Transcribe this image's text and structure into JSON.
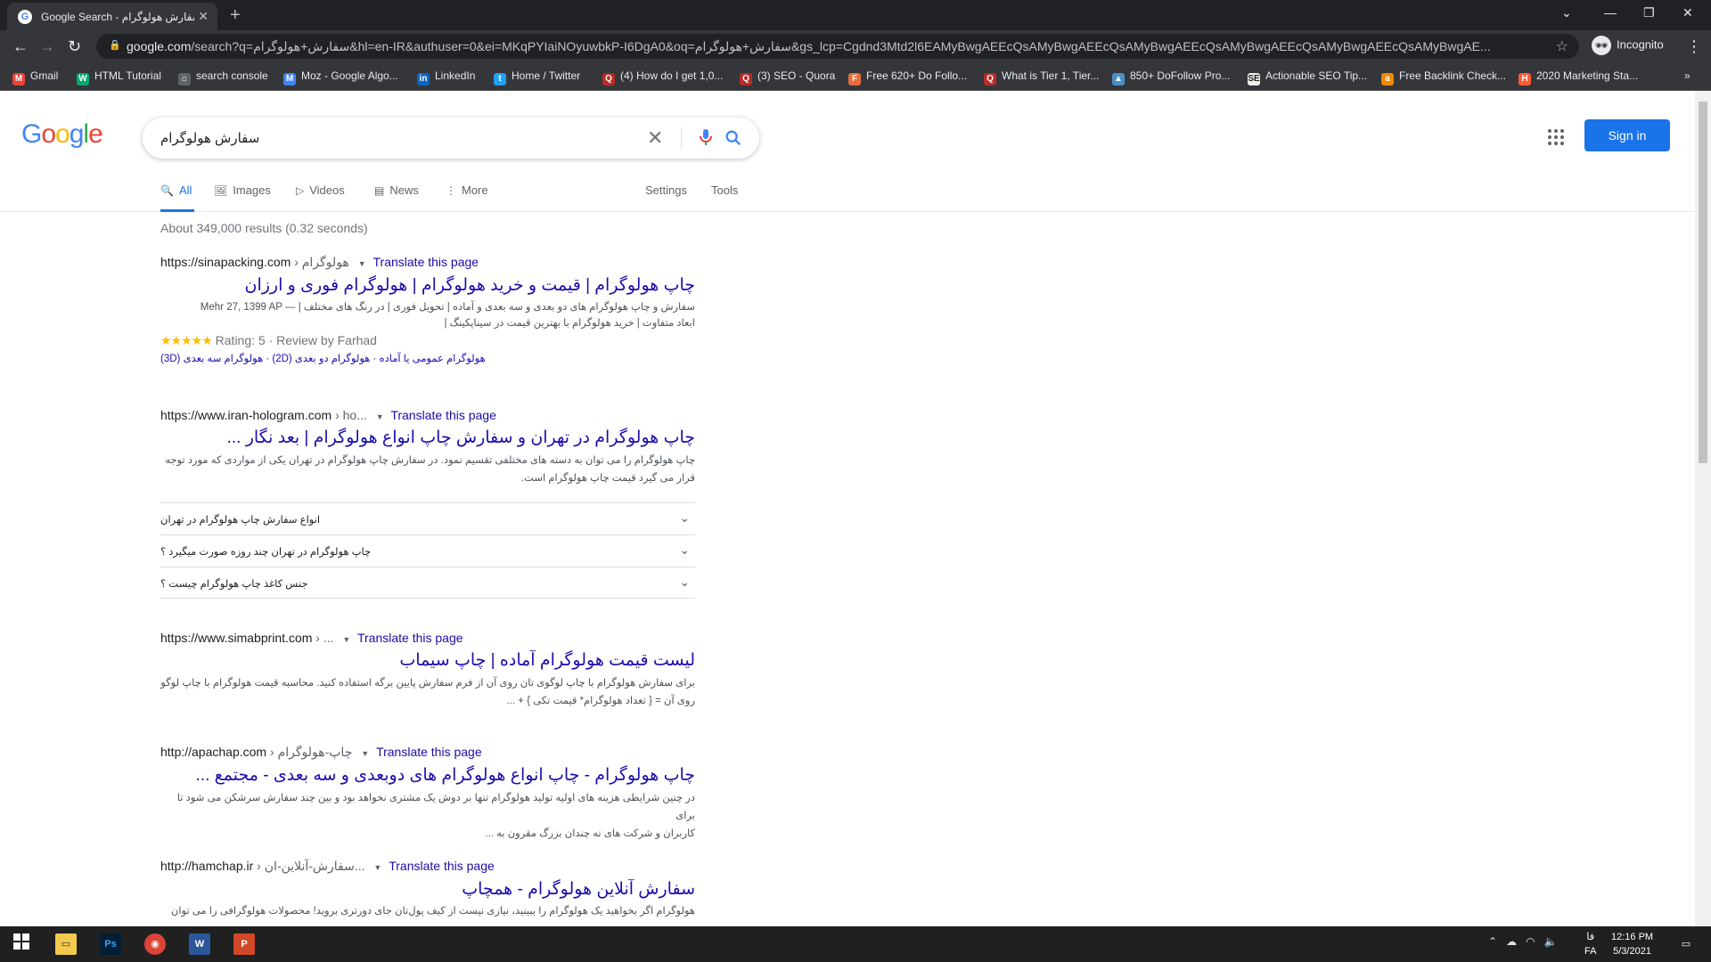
{
  "browser": {
    "tab_title": "Google Search - سفارش هولوگرام",
    "url_host": "google.com",
    "url_rest": "/search?q=سفارش+هولوگرام&hl=en-IR&authuser=0&ei=MKqPYIaiNOyuwbkP-I6DgA0&oq=سفارش+هولوگرام&gs_lcp=Cgdnd3Mtd2l6EAMyBwgAEEcQsAMyBwgAEEcQsAMyBwgAEEcQsAMyBwgAEEcQsAMyBwgAEEcQsAMyBwgAE...",
    "profile_label": "Incognito",
    "bookmarks": [
      "Gmail",
      "HTML Tutorial",
      "search console",
      "Moz - Google Algo...",
      "LinkedIn",
      "Home / Twitter",
      "(4) How do I get 1,0...",
      "(3) SEO - Quora",
      "Free 620+ Do Follo...",
      "What is Tier 1, Tier...",
      "850+ DoFollow Pro...",
      "Actionable SEO Tip...",
      "Free Backlink Check...",
      "2020 Marketing Sta..."
    ]
  },
  "google": {
    "query": "سفارش هولوگرام",
    "signin_label": "Sign in",
    "tabs": [
      "All",
      "Images",
      "Videos",
      "News",
      "More"
    ],
    "settings_label": "Settings",
    "tools_label": "Tools",
    "stats": "About 349,000 results (0.32 seconds)",
    "translate_label": "Translate this page"
  },
  "results": [
    {
      "url": "https://sinapacking.com",
      "path": "› هولوگرام",
      "title": "چاپ هولوگرام | قیمت و خرید هولوگرام | هولوگرام فوری و ارزان",
      "snippet_line1": "سفارش و چاپ هولوگرام های دو بعدی و سه بعدی و آماده | تحویل فوری | در رنگ های مختلف | — Mehr 27, 1399 AP",
      "snippet_line2": "ابعاد متفاوت | خرید هولوگرام با بهترین قیمت در سیناپکینگ |",
      "rating_text": "Rating: 5 · Review by Farhad",
      "stars": "★★★★★",
      "sitelinks": "هولوگرام عمومی یا آماده · هولوگرام دو بعدی (2D) · هولوگرام سه بعدی (3D)"
    },
    {
      "url": "https://www.iran-hologram.com",
      "path": "› ho...",
      "title": "چاپ هولوگرام در تهران و سفارش چاپ انواع هولوگرام | بعد نگار ...",
      "snippet_line1": "چاپ هولوگرام را می توان به دسته های مختلفی تقسیم نمود. در سفارش چاپ هولوگرام در تهران یکی از مواردی که مورد توجه",
      "snippet_line2": "قرار می گیرد قیمت چاپ هولوگرام است.",
      "faqs": [
        "انواع سفارش چاپ هولوگرام در تهران",
        "چاپ هولوگرام در تهران چند روزه صورت میگیرد ؟",
        "جنس کاغذ چاپ هولوگرام چیست ؟"
      ]
    },
    {
      "url": "https://www.simabprint.com",
      "path": "› ...",
      "title": "لیست قیمت هولوگرام آماده | چاپ سیماب",
      "snippet_line1": "برای سفارش هولوگرام با چاپ لوگوی تان روی آن از فرم سفارش پایین برگه استفاده کنید. محاسبه قیمت هولوگرام با چاپ لوگو",
      "snippet_line2": "روی آن = { تعداد هولوگرام* قیمت تکی } + ..."
    },
    {
      "url": "http://apachap.com",
      "path": "› چاپ-هولوگرام",
      "title": "چاپ هولوگرام - چاپ انواع هولوگرام های دوبعدی و سه بعدی - مجتمع ...",
      "snippet_line1": "در چنین شرایطی هزینه های اولیه تولید هولوگرام تنها بر دوش یک مشتری نخواهد بود و بین چند سفارش سرشکن می شود تا برای",
      "snippet_line2": "کاربران و شرکت های نه چندان بزرگ مقرون به ..."
    },
    {
      "url": "http://hamchap.ir",
      "path": "› سفارش-آنلاین-ان...",
      "title": "سفارش آنلاین هولوگرام - همچاپ",
      "snippet_line1": "هولوگرام اگر بخواهید یک هولوگرام را ببینید، نیازی نیست از کیف پول‌تان جای دورتری بروید! محصولات هولوگرافی را می توان"
    }
  ],
  "taskbar": {
    "time": "12:16 PM",
    "date": "5/3/2021",
    "lang_top": "فا",
    "lang_bottom": "FA"
  },
  "colors": {
    "link": "#1a0dab",
    "accent": "#1a73e8",
    "star": "#fbbc04"
  }
}
